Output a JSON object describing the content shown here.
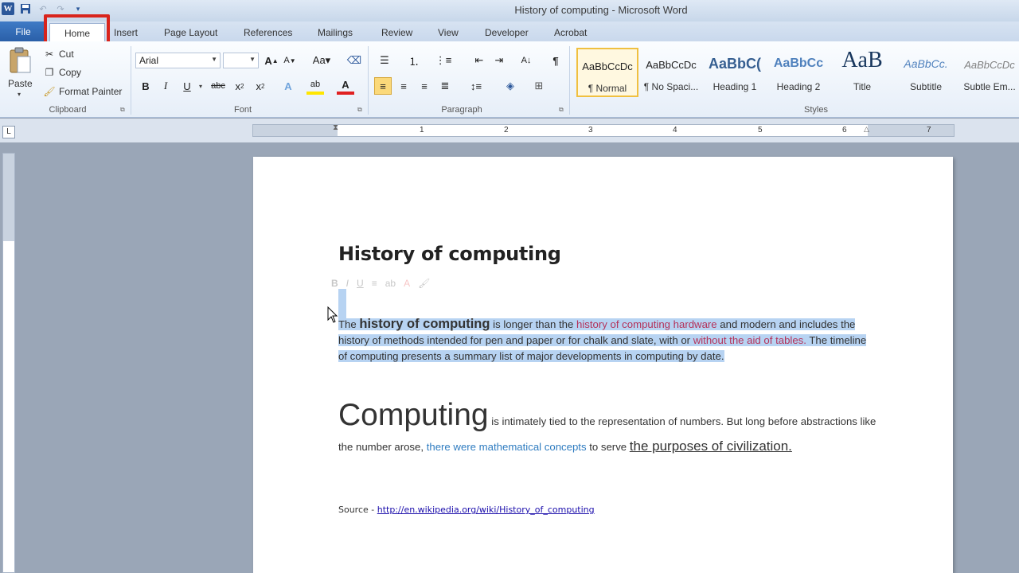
{
  "window": {
    "title": "History of computing  -  Microsoft Word"
  },
  "tabs": {
    "file": "File",
    "home": "Home",
    "insert": "Insert",
    "page_layout": "Page Layout",
    "references": "References",
    "mailings": "Mailings",
    "review": "Review",
    "view": "View",
    "developer": "Developer",
    "acrobat": "Acrobat"
  },
  "clipboard": {
    "label": "Clipboard",
    "paste": "Paste",
    "cut": "Cut",
    "copy": "Copy",
    "format_painter": "Format Painter"
  },
  "font": {
    "label": "Font",
    "name": "Arial",
    "size": ""
  },
  "paragraph": {
    "label": "Paragraph"
  },
  "styles": {
    "label": "Styles",
    "items": [
      {
        "preview": "AaBbCcDc",
        "name": "¶ Normal"
      },
      {
        "preview": "AaBbCcDc",
        "name": "¶ No Spaci..."
      },
      {
        "preview": "AaBbC(",
        "name": "Heading 1"
      },
      {
        "preview": "AaBbCc",
        "name": "Heading 2"
      },
      {
        "preview": "AaB",
        "name": "Title"
      },
      {
        "preview": "AaBbCc.",
        "name": "Subtitle"
      },
      {
        "preview": "AaBbCcDc",
        "name": "Subtle Em..."
      }
    ]
  },
  "ruler": {
    "numbers": [
      "1",
      "2",
      "3",
      "4",
      "5",
      "6",
      "7"
    ]
  },
  "document": {
    "title": "History of computing",
    "p1": {
      "t1": "The ",
      "t2": "history of computing",
      "t3": " is longer than the ",
      "t4": "history of computing hardware",
      "t5": " and modern and includes the history of methods intended for pen and paper or for chalk and slate, with or ",
      "t6": "without the aid of tables.",
      "t7": " The timeline of computing presents a summary list of major developments in computing by date."
    },
    "p2": {
      "t1": "Computing",
      "t2": " is intimately tied to the representation of numbers. But long before abstractions like the number arose, ",
      "t3": "there were mathematical concepts",
      "t4": " to serve ",
      "t5": "the purposes of civilization."
    },
    "source_label": "Source - ",
    "source_link": "http://en.wikipedia.org/wiki/History_of_computing"
  },
  "colors": {
    "accent": "#2b579a",
    "highlight_box": "#d9241c",
    "selection": "#b7d3f2",
    "red_text": "#b4325a",
    "blue_text": "#2f7cc0"
  }
}
